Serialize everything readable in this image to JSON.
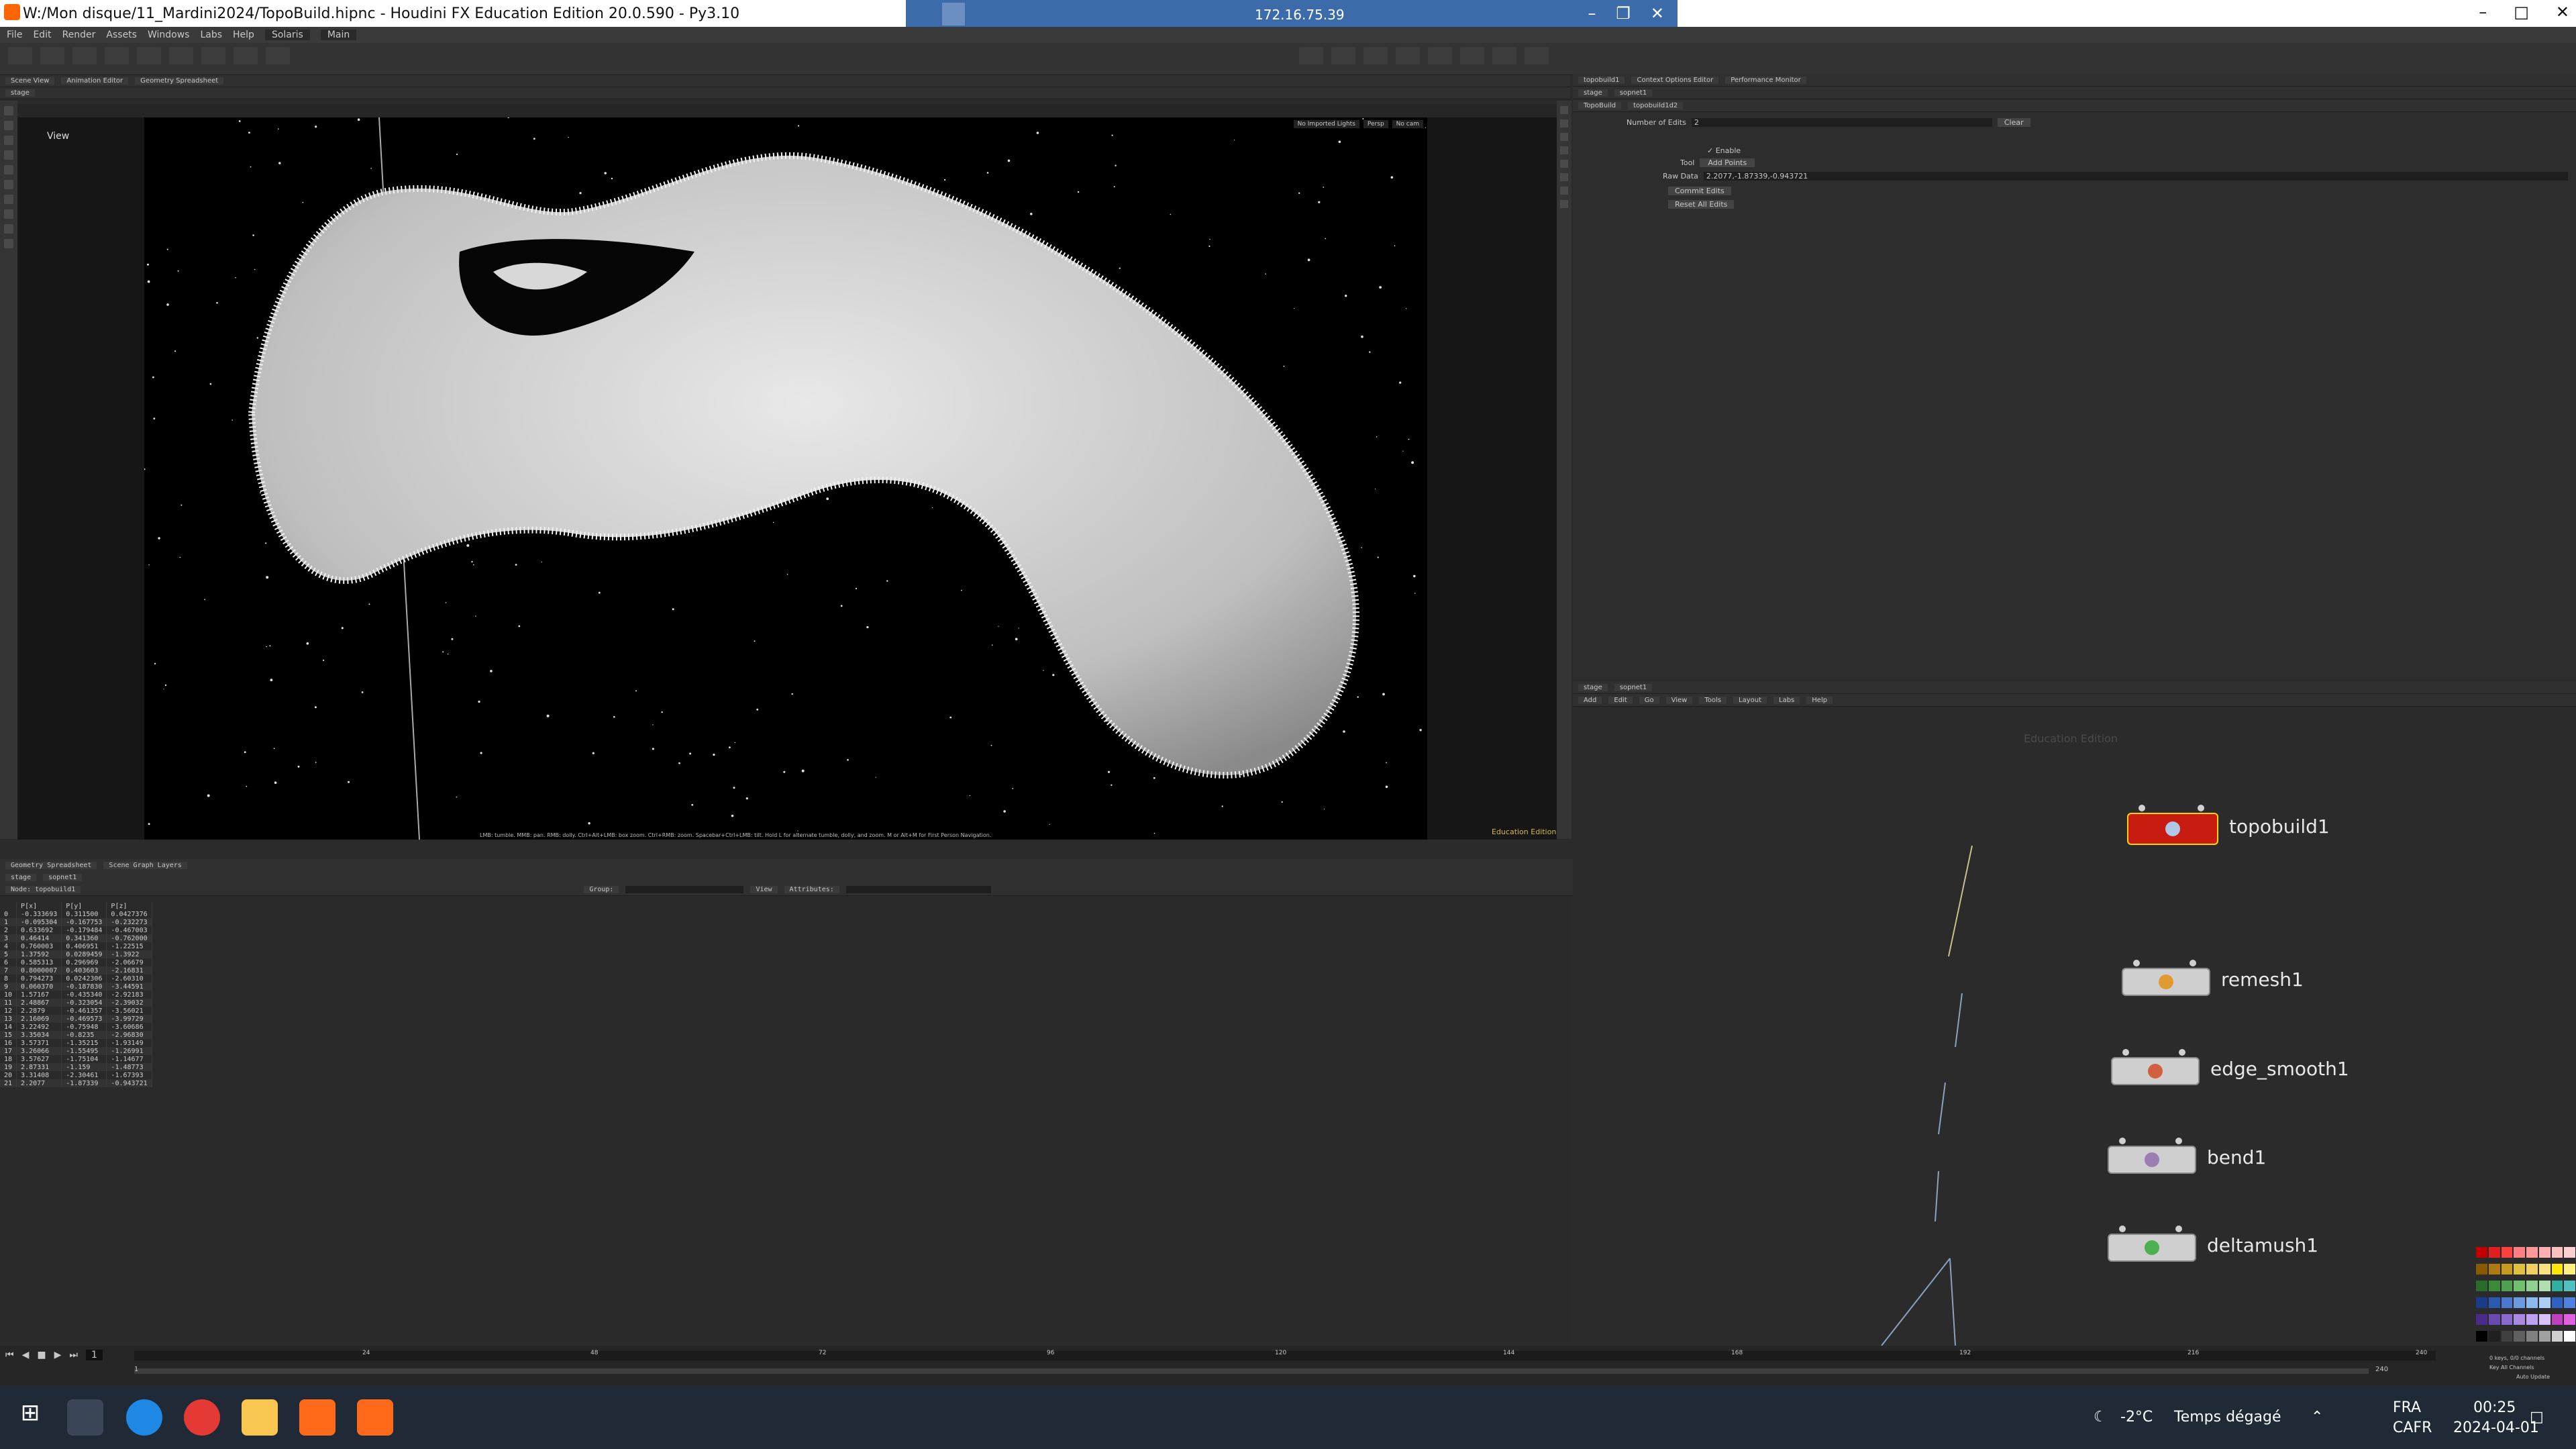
{
  "window": {
    "title": "W:/Mon disque/11_Mardini2024/TopoBuild.hipnc - Houdini FX Education Edition 20.0.590 - Py3.10",
    "remote_ip": "172.16.75.39"
  },
  "menu": [
    "File",
    "Edit",
    "Render",
    "Assets",
    "Windows",
    "Labs",
    "Help",
    "Solaris",
    "Main"
  ],
  "left_tabs": [
    "Scene View",
    "Animation Editor",
    "Geometry Spreadsheet"
  ],
  "viewport": {
    "path": "stage",
    "view_label": "View",
    "persp": "Persp",
    "camera": "No cam",
    "no_light": "No Imported Lights",
    "status_hint": "LMB: tumble. MMB: pan. RMB: dolly. Ctrl+Alt+LMB: box zoom. Ctrl+RMB: zoom. Spacebar+Ctrl+LMB: tilt. Hold L for alternate tumble, dolly, and zoom. M or Alt+M for First Person Navigation.",
    "watermark": "Education Edition"
  },
  "spreadsheet": {
    "tabs": [
      "Geometry Spreadsheet",
      "Scene Graph Layers"
    ],
    "node_label": "Node: topobuild1",
    "group_label": "Group:",
    "view_label": "View",
    "attributes_label": "Attributes:",
    "columns": [
      "",
      "P[x]",
      "P[y]",
      "P[z]"
    ],
    "rows": [
      [
        "0",
        "-0.333693",
        "0.311500",
        "0.0427376"
      ],
      [
        "1",
        "-0.095304",
        "-0.167753",
        "-0.232273"
      ],
      [
        "2",
        "0.633692",
        "-0.179484",
        "-0.467003"
      ],
      [
        "3",
        "0.46414",
        "0.341360",
        "-0.762000"
      ],
      [
        "4",
        "0.760003",
        "0.406951",
        "-1.22515"
      ],
      [
        "5",
        "1.37592",
        "0.0289459",
        "-1.3922"
      ],
      [
        "6",
        "0.585313",
        "0.296969",
        "-2.06679"
      ],
      [
        "7",
        "0.8000007",
        "0.403603",
        "-2.16831"
      ],
      [
        "8",
        "0.794273",
        "0.0242306",
        "-2.60310"
      ],
      [
        "9",
        "0.060370",
        "-0.187830",
        "-3.44591"
      ],
      [
        "10",
        "1.57167",
        "-0.435340",
        "-2.92183"
      ],
      [
        "11",
        "2.48867",
        "-0.323054",
        "-2.39032"
      ],
      [
        "12",
        "2.2879",
        "-0.461357",
        "-3.56021"
      ],
      [
        "13",
        "2.16069",
        "-0.469573",
        "-3.99729"
      ],
      [
        "14",
        "3.22492",
        "-0.75948",
        "-3.60686"
      ],
      [
        "15",
        "3.35034",
        "-0.8235",
        "-2.96830"
      ],
      [
        "16",
        "3.57371",
        "-1.35215",
        "-1.93149"
      ],
      [
        "17",
        "3.26066",
        "-1.55495",
        "-1.26991"
      ],
      [
        "18",
        "3.57627",
        "-1.75104",
        "-1.14677"
      ],
      [
        "19",
        "2.87331",
        "-1.159",
        "-1.48773"
      ],
      [
        "20",
        "3.31408",
        "-2.30461",
        "-1.67393"
      ],
      [
        "21",
        "2.2077",
        "-1.87339",
        "-0.943721"
      ]
    ]
  },
  "params": {
    "tabs": [
      "topobuild1",
      "Context Options Editor",
      "Performance Monitor"
    ],
    "node_type": "TopoBuild",
    "node_name": "topobuild1d2",
    "num_edits_label": "Number of Edits",
    "num_edits_value": "2",
    "clear_label": "Clear",
    "enable_label": "Enable",
    "tool_label": "Tool",
    "tool_value": "Add Points",
    "raw_data_label": "Raw Data",
    "raw_data_value": "2.2077,-1.87339,-0.943721",
    "commit_label": "Commit Edits",
    "reset_label": "Reset All Edits"
  },
  "network": {
    "path": "stage",
    "subpath": "sopnet1",
    "menu": [
      "Add",
      "Edit",
      "Go",
      "View",
      "Tools",
      "Layout",
      "Labs",
      "Help"
    ],
    "watermark": "Education Edition",
    "nodes": [
      {
        "name": "topobuild1",
        "selected": true,
        "icon_color": "#b0c8e8"
      },
      {
        "name": "remesh1",
        "selected": false,
        "icon_color": "#e09a30"
      },
      {
        "name": "edge_smooth1",
        "selected": false,
        "icon_color": "#d06040"
      },
      {
        "name": "bend1",
        "selected": false,
        "icon_color": "#9a80b0"
      },
      {
        "name": "deltamush1",
        "selected": false,
        "icon_color": "#4caf50"
      }
    ]
  },
  "timeline": {
    "frame": "1",
    "start": "1",
    "end": "240",
    "ticks": [
      "24",
      "48",
      "72",
      "96",
      "120",
      "144",
      "168",
      "192",
      "216",
      "240"
    ],
    "keys_label": "0 keys, 0/0 channels",
    "key_all_label": "Key All Channels",
    "auto_update": "Auto Update"
  },
  "taskbar": {
    "weather_temp": "-2°C",
    "weather_text": "Temps dégagé",
    "lang": "FRA",
    "layout": "CAFR",
    "time": "00:25",
    "date": "2024-04-01"
  }
}
